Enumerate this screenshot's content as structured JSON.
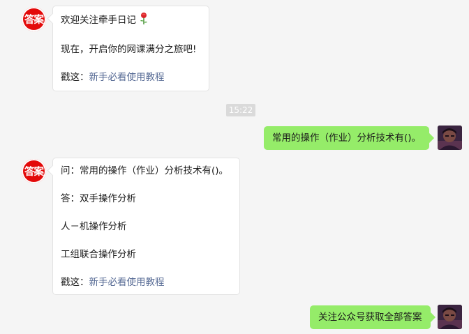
{
  "bot": {
    "avatar_text": "答案"
  },
  "messages": {
    "m1": {
      "line1": "欢迎关注牵手日记",
      "emoji": "rose-emoji",
      "line2": "现在，开启你的网课满分之旅吧!",
      "link_prefix": "戳这：",
      "link_text": "新手必看使用教程"
    },
    "time": "15:22",
    "m2": "常用的操作（作业）分析技术有()。",
    "m3": {
      "question": "问：常用的操作（作业）分析技术有()。",
      "answer": "答：双手操作分析",
      "option2": "人－机操作分析",
      "option3": "工组联合操作分析",
      "link_prefix": "戳这：",
      "link_text": "新手必看使用教程"
    },
    "m4": "关注公众号获取全部答案"
  },
  "colors": {
    "background": "#f5f5f5",
    "bot_avatar": "#e30a0a",
    "user_bubble": "#95ec69",
    "link": "#576b95",
    "time_badge": "#dadada"
  }
}
